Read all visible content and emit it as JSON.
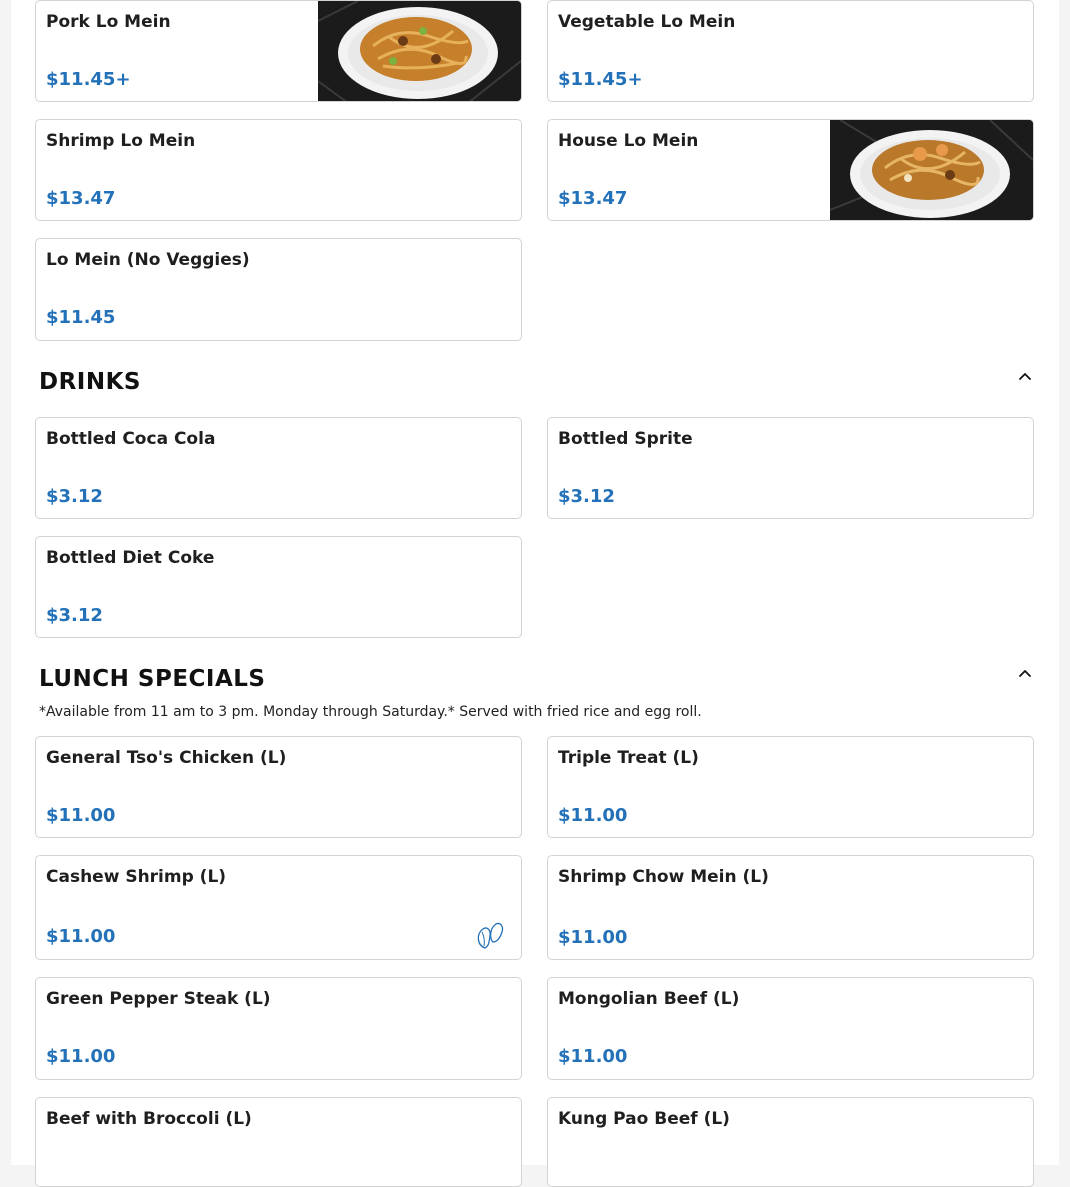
{
  "lo_mein_items": [
    {
      "name": "Pork Lo Mein",
      "price": "$11.45+"
    },
    {
      "name": "Vegetable Lo Mein",
      "price": "$11.45+"
    },
    {
      "name": "Shrimp Lo Mein",
      "price": "$13.47"
    },
    {
      "name": "House Lo Mein",
      "price": "$13.47"
    },
    {
      "name": "Lo Mein (No Veggies)",
      "price": "$11.45"
    }
  ],
  "drinks": {
    "title": "DRINKS",
    "items": [
      {
        "name": "Bottled Coca Cola",
        "price": "$3.12"
      },
      {
        "name": "Bottled Sprite",
        "price": "$3.12"
      },
      {
        "name": "Bottled Diet Coke",
        "price": "$3.12"
      }
    ]
  },
  "lunch_specials": {
    "title": "LUNCH SPECIALS",
    "note": "*Available from 11 am to 3 pm. Monday through Saturday.* Served with fried rice and egg roll.",
    "items": [
      {
        "name": "General Tso's Chicken (L)",
        "price": "$11.00"
      },
      {
        "name": "Triple Treat (L)",
        "price": "$11.00"
      },
      {
        "name": "Cashew Shrimp (L)",
        "price": "$11.00"
      },
      {
        "name": "Shrimp Chow Mein (L)",
        "price": "$11.00"
      },
      {
        "name": "Green Pepper Steak (L)",
        "price": "$11.00"
      },
      {
        "name": "Mongolian Beef (L)",
        "price": "$11.00"
      },
      {
        "name": "Beef with Broccoli (L)",
        "price": ""
      },
      {
        "name": "Kung Pao Beef (L)",
        "price": ""
      }
    ]
  },
  "colors": {
    "price": "#2371b8",
    "border": "#d3d3d3",
    "nut_icon": "#2371b8"
  },
  "icons": {
    "collapse": "chevron-up-icon",
    "allergen": "nut-icon"
  }
}
